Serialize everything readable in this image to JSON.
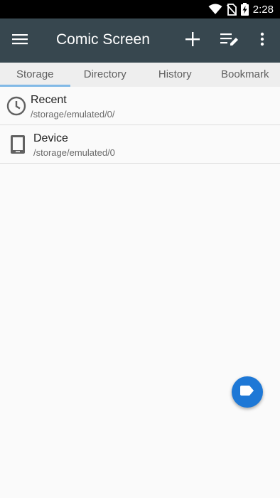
{
  "status_bar": {
    "time": "2:28",
    "icons": [
      "wifi-icon",
      "no-sim-icon",
      "battery-charging-icon"
    ]
  },
  "app_bar": {
    "title": "Comic Screen",
    "actions": [
      "menu-icon",
      "add-icon",
      "edit-list-icon",
      "more-vert-icon"
    ],
    "color": "#37474f"
  },
  "tabs": [
    {
      "label": "Storage",
      "active": true
    },
    {
      "label": "Directory",
      "active": false
    },
    {
      "label": "History",
      "active": false
    },
    {
      "label": "Bookmark",
      "active": false
    }
  ],
  "list": [
    {
      "icon": "clock-icon",
      "title": "Recent",
      "path": "/storage/emulated/0/"
    },
    {
      "icon": "tablet-device-icon",
      "title": "Device",
      "path": "/storage/emulated/0"
    }
  ],
  "fab": {
    "icon": "label-tag-icon",
    "color": "#1e78d6"
  },
  "accent_color": "#81b9e6"
}
